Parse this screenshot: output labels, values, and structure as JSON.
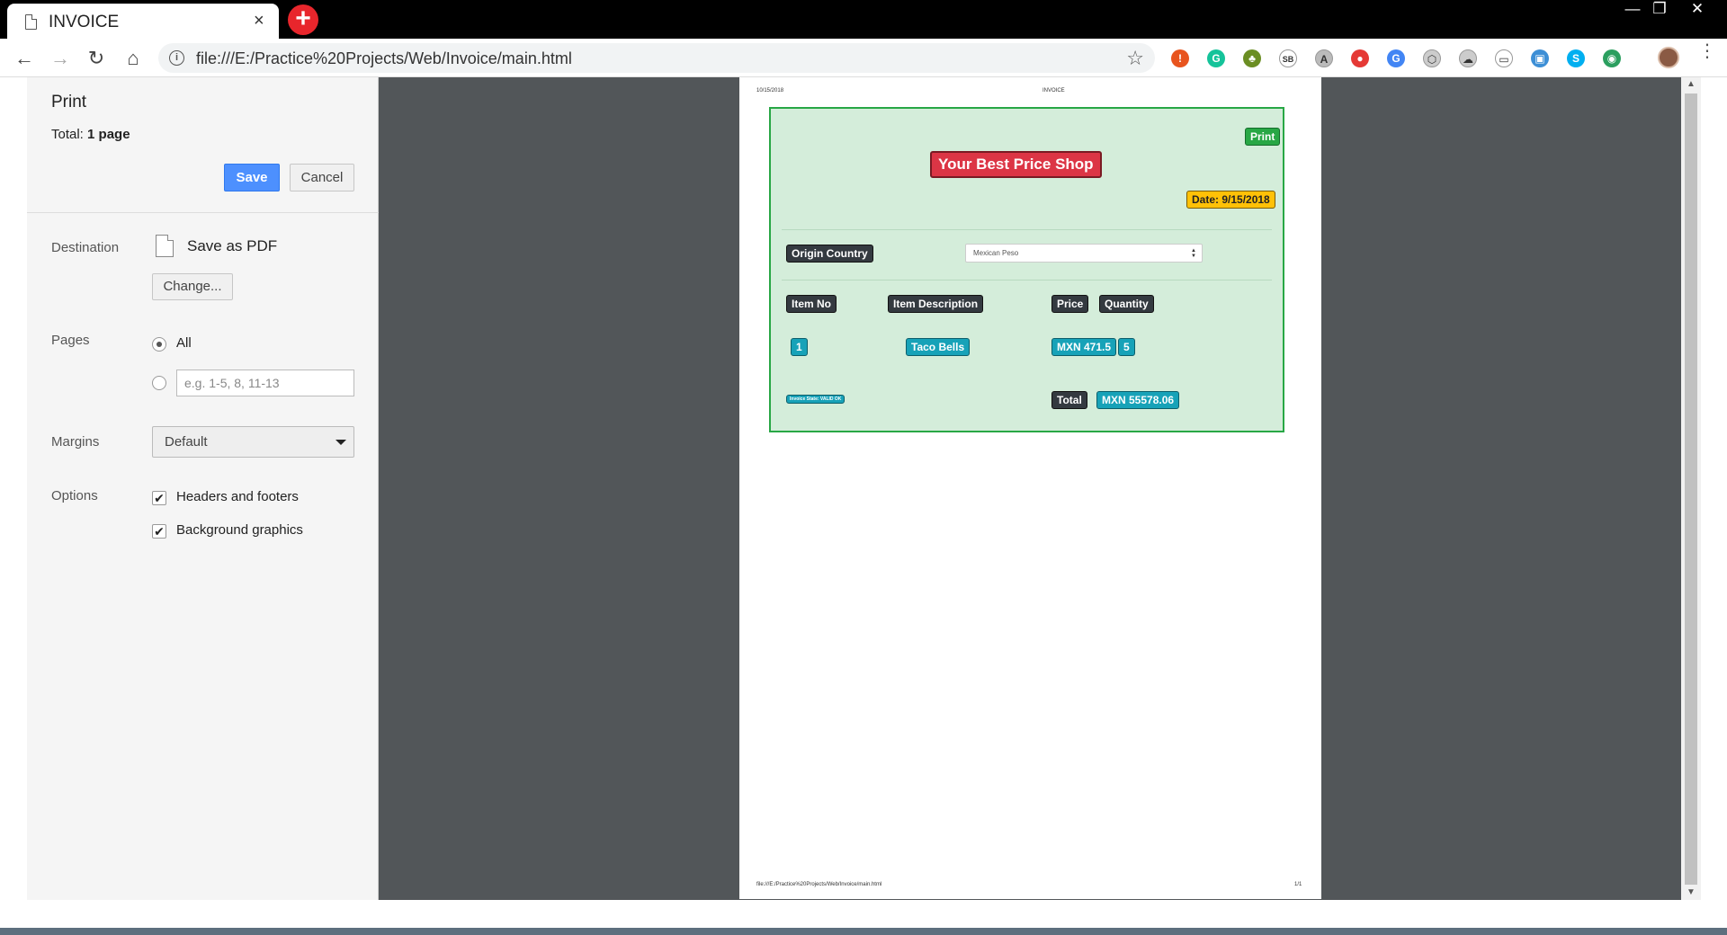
{
  "browser": {
    "tab_title": "INVOICE",
    "tab_close": "×",
    "new_tab": "+",
    "url": "file:///E:/Practice%20Projects/Web/Invoice/main.html",
    "window_controls": [
      "—",
      "❐",
      "✕"
    ],
    "nav": {
      "back": "←",
      "forward": "→",
      "reload": "↻",
      "home": "⌂"
    },
    "info_glyph": "i",
    "star_glyph": "☆",
    "extensions": [
      {
        "name": "alert-extension-icon",
        "glyph": "!",
        "color": "#e8541e"
      },
      {
        "name": "grammarly-extension-icon",
        "glyph": "G",
        "color": "#15c39a"
      },
      {
        "name": "plant-extension-icon",
        "glyph": "♣",
        "color": "#6b8e23"
      },
      {
        "name": "sb-extension-icon",
        "glyph": "SB",
        "color": "#ffffff"
      },
      {
        "name": "unknown-extension-icon",
        "glyph": "A",
        "color": "#bbbbbb"
      },
      {
        "name": "stop-extension-icon",
        "glyph": "●",
        "color": "#e53935"
      },
      {
        "name": "translate-extension-icon",
        "glyph": "G",
        "color": "#4285f4"
      },
      {
        "name": "cube-extension-icon",
        "glyph": "⬡",
        "color": "#cccccc"
      },
      {
        "name": "cloud-extension-icon",
        "glyph": "☁",
        "color": "#cccccc"
      },
      {
        "name": "cast-extension-icon",
        "glyph": "▭",
        "color": "#ffffff"
      },
      {
        "name": "desktop-extension-icon",
        "glyph": "▣",
        "color": "#3d8fd6"
      },
      {
        "name": "skype-extension-icon",
        "glyph": "S",
        "color": "#00aff0"
      },
      {
        "name": "globe-extension-icon",
        "glyph": "◉",
        "color": "#2b9f5f"
      }
    ]
  },
  "print_panel": {
    "title": "Print",
    "total_label": "Total:",
    "total_value": "1 page",
    "save_label": "Save",
    "cancel_label": "Cancel",
    "destination_label": "Destination",
    "destination_value": "Save as PDF",
    "change_label": "Change...",
    "pages_label": "Pages",
    "pages_all_label": "All",
    "pages_custom_placeholder": "e.g. 1-5, 8, 11-13",
    "margins_label": "Margins",
    "margins_value": "Default",
    "options_label": "Options",
    "option_headers_footers": "Headers and footers",
    "option_background_graphics": "Background graphics",
    "check_glyph": "✔"
  },
  "preview": {
    "header_date": "10/15/2018",
    "header_title": "INVOICE",
    "footer_url": "file:///E:/Practice%20Projects/Web/Invoice/main.html",
    "footer_page": "1/1",
    "invoice": {
      "print_button": "Print",
      "shop_name": "Your Best Price Shop",
      "date": "Date: 9/15/2018",
      "origin_country_label": "Origin Country",
      "currency_select": "Mexican Peso",
      "col_item_no": "Item No",
      "col_item_description": "Item Description",
      "col_price": "Price",
      "col_quantity": "Quantity",
      "item_no": "1",
      "item_description": "Taco Bells",
      "item_price": "MXN 471.5",
      "item_quantity": "5",
      "invoice_state": "Invoice State: VALID OK",
      "total_label": "Total",
      "total_value": "MXN 55578.06"
    }
  },
  "colors": {
    "print_btn": "#28a745",
    "shop_badge": "#dc3545",
    "date_badge": "#ffc107",
    "card_bg": "#d4edda",
    "info_badge": "#17a2b8",
    "dark_badge": "#343a40"
  }
}
